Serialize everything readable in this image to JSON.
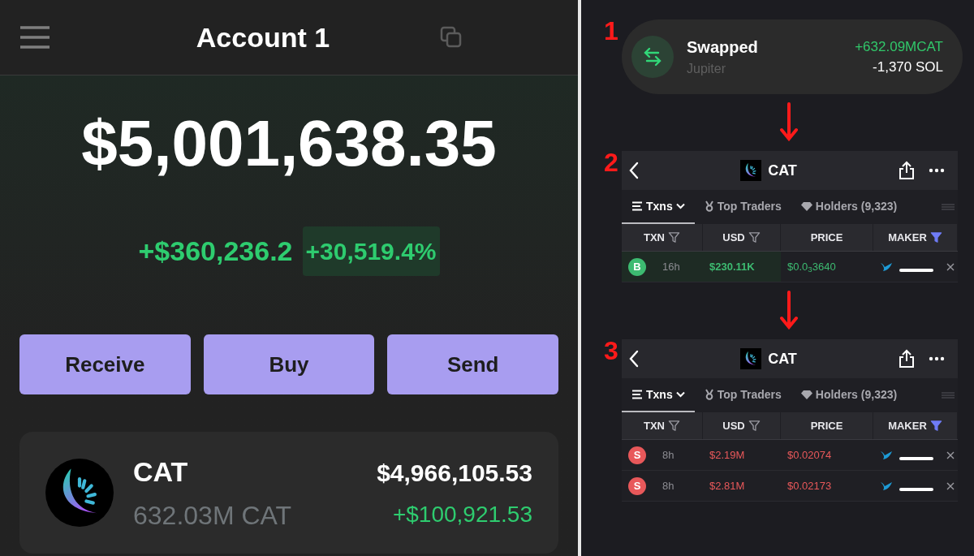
{
  "wallet": {
    "title": "Account 1",
    "balance": "$5,001,638.35",
    "change_usd": "+$360,236.2",
    "change_pct": "+30,519.4%",
    "actions": [
      "Receive",
      "Buy",
      "Send"
    ],
    "token": {
      "symbol": "CAT",
      "amount": "632.03M CAT",
      "value": "$4,966,105.53",
      "change": "+$100,921.53"
    }
  },
  "steps": [
    {
      "label": "1",
      "kind": "swap",
      "title": "Swapped",
      "subtitle": "Jupiter",
      "received": "+632.09MCAT",
      "sent": "-1,370 SOL"
    },
    {
      "label": "2",
      "kind": "txns",
      "token": "CAT",
      "tabs": [
        {
          "label": "Txns",
          "selected": true
        },
        {
          "label": "Top Traders",
          "selected": false
        },
        {
          "label": "Holders (9,323)",
          "selected": false
        }
      ],
      "columns": [
        {
          "label": "TXN",
          "filter_active": false
        },
        {
          "label": "USD",
          "filter_active": false
        },
        {
          "label": "PRICE"
        },
        {
          "label": "MAKER",
          "filter_active": true
        }
      ],
      "rows": [
        {
          "side": "B",
          "color": "#3dbb71",
          "age": "16h",
          "usd": "$230.11K",
          "price": "$0.0$_{3}$3640",
          "highlighted": true
        }
      ]
    },
    {
      "label": "3",
      "kind": "txns",
      "token": "CAT",
      "tabs": [
        {
          "label": "Txns",
          "selected": true
        },
        {
          "label": "Top Traders",
          "selected": false
        },
        {
          "label": "Holders (9,323)",
          "selected": false
        }
      ],
      "columns": [
        {
          "label": "TXN",
          "filter_active": false
        },
        {
          "label": "USD",
          "filter_active": false
        },
        {
          "label": "PRICE"
        },
        {
          "label": "MAKER",
          "filter_active": true
        }
      ],
      "rows": [
        {
          "side": "S",
          "color": "#e8585a",
          "age": "8h",
          "usd": "$2.19M",
          "price": "$0.02074",
          "highlighted": false
        },
        {
          "side": "S",
          "color": "#e8585a",
          "age": "8h",
          "usd": "$2.81M",
          "price": "$0.02173",
          "highlighted": false
        }
      ]
    }
  ]
}
